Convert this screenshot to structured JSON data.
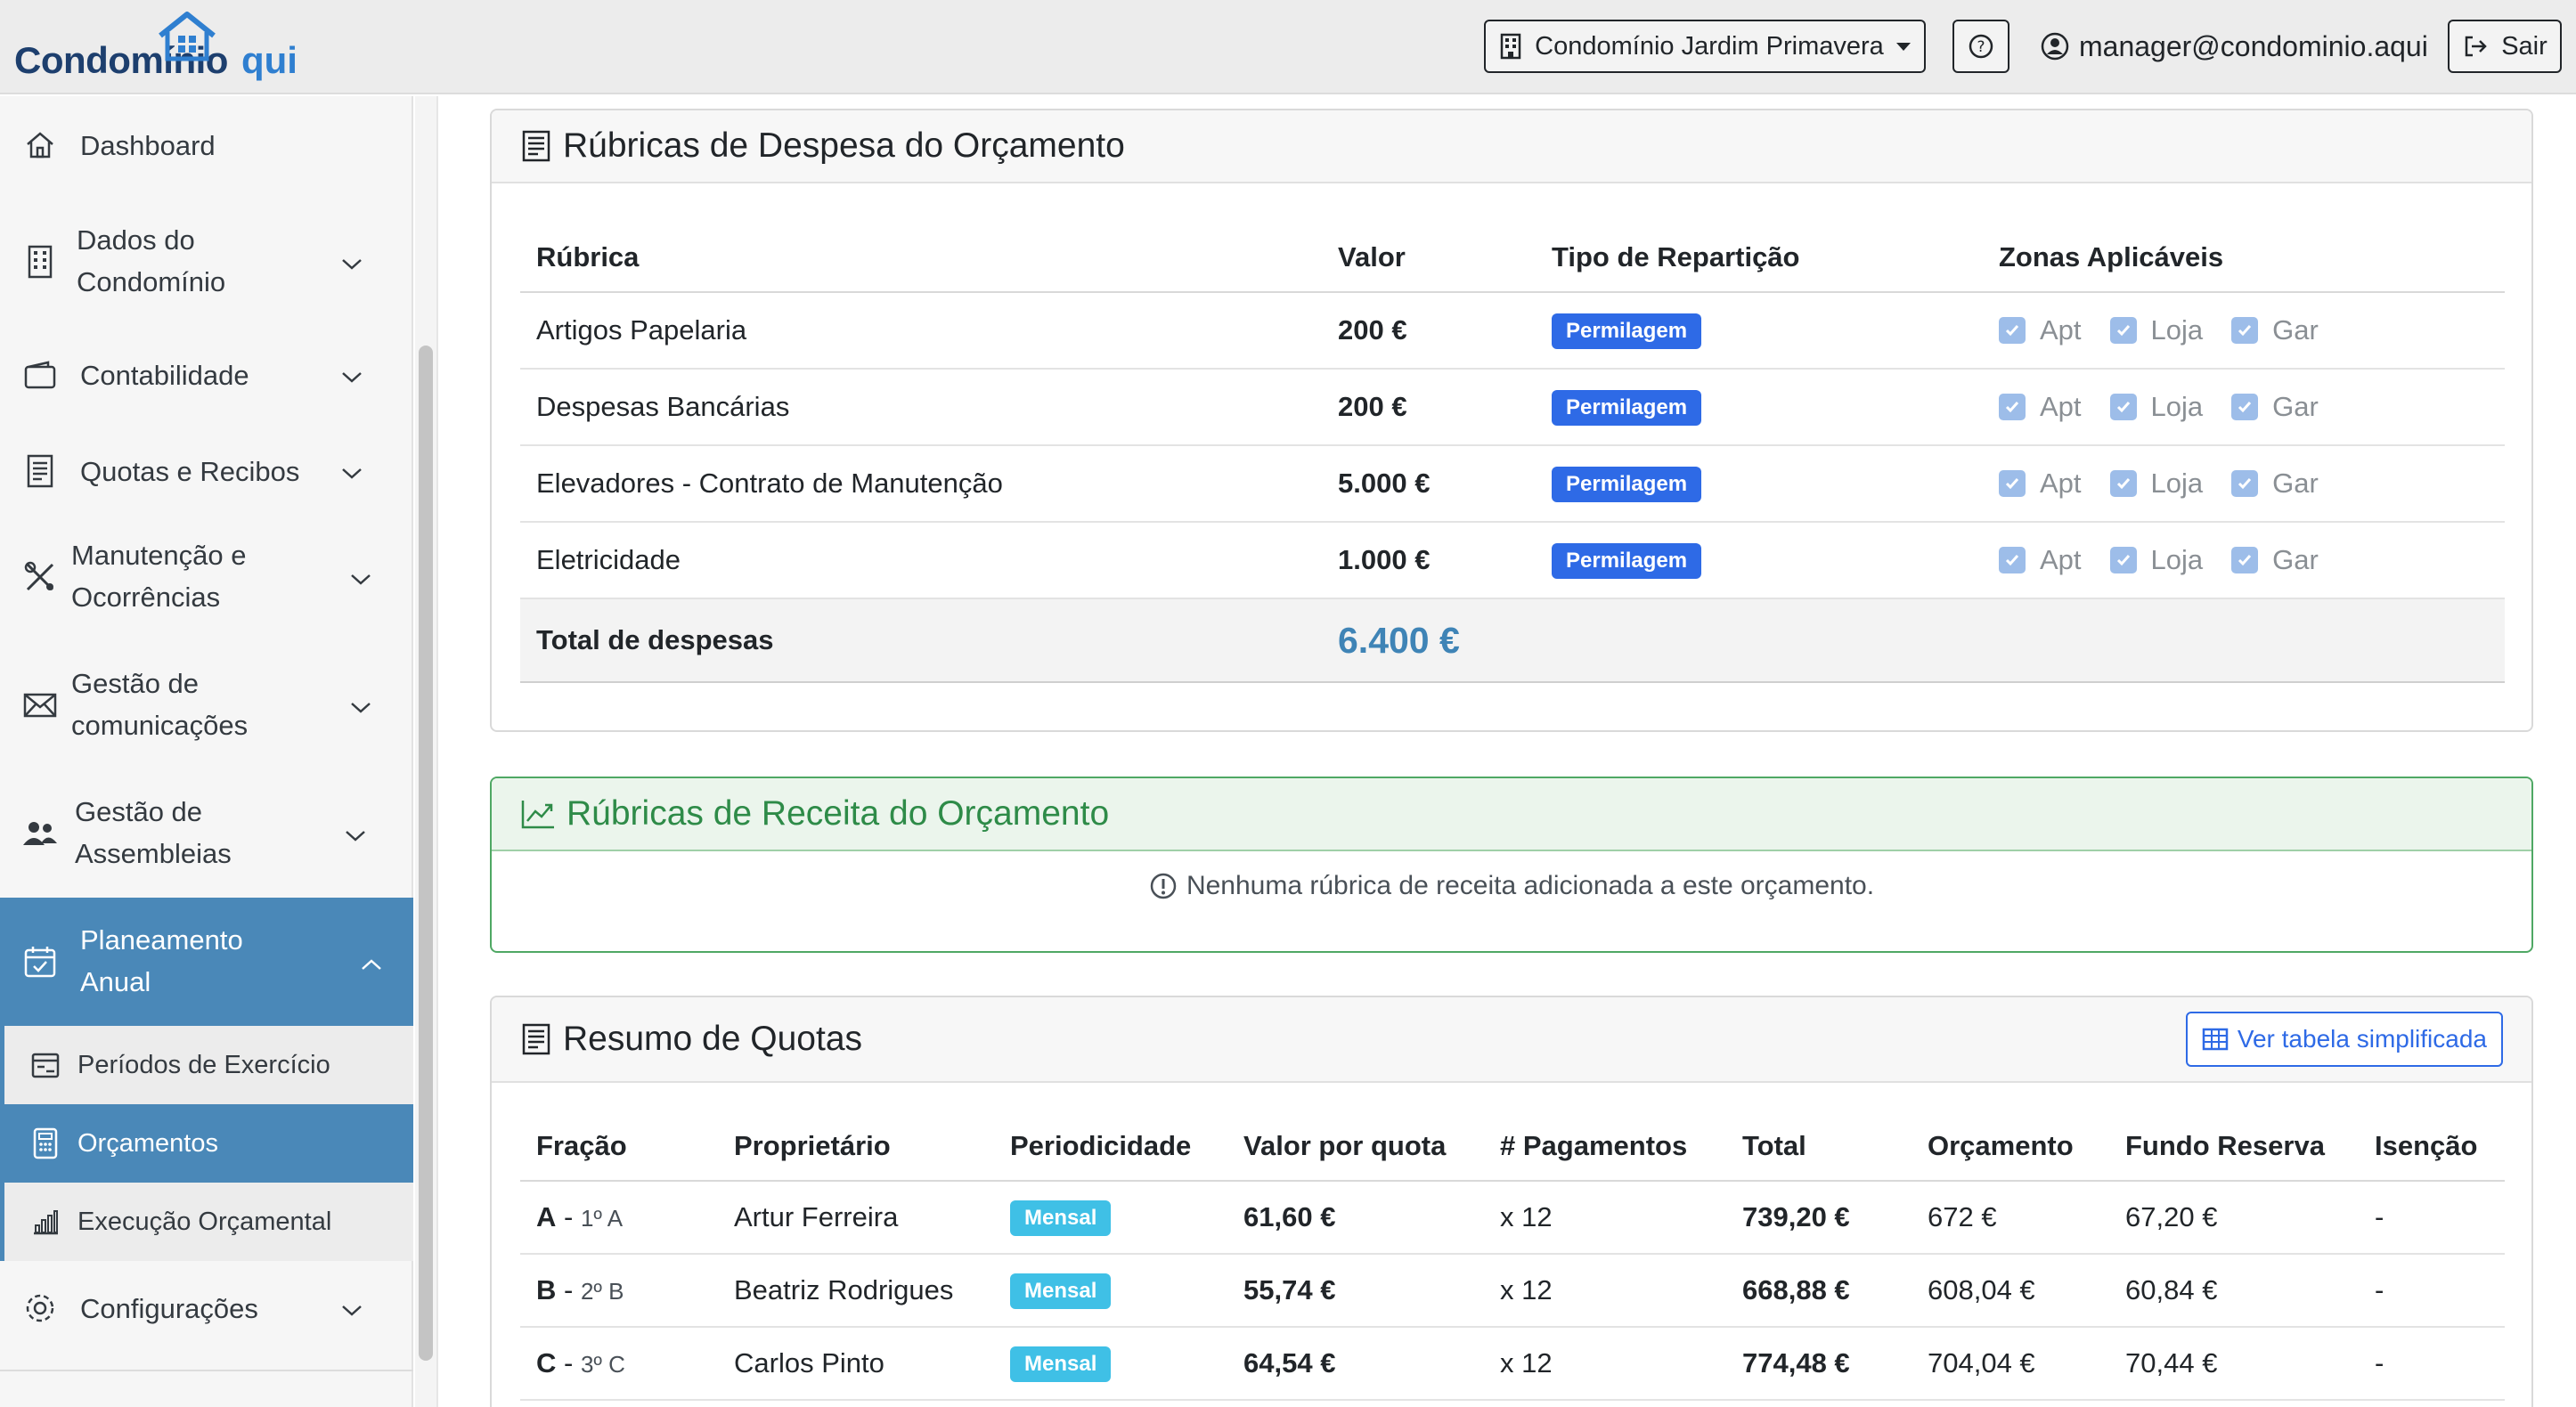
{
  "brand": {
    "part1": "Condomínio",
    "part2": "qui"
  },
  "topbar": {
    "condo_select": "Condomínio Jardim Primavera",
    "user_email": "manager@condominio.aqui",
    "logout_label": "Sair"
  },
  "sidebar": {
    "dashboard": "Dashboard",
    "dados_line1": "Dados do",
    "dados_line2": "Condomínio",
    "contabilidade": "Contabilidade",
    "quotas": "Quotas e Recibos",
    "manut_line1": "Manutenção e",
    "manut_line2": "Ocorrências",
    "comm_line1": "Gestão de",
    "comm_line2": "comunicações",
    "assem_line1": "Gestão de",
    "assem_line2": "Assembleias",
    "plan_line1": "Planeamento",
    "plan_line2": "Anual",
    "sub_periodos": "Períodos de Exercício",
    "sub_orcamentos": "Orçamentos",
    "sub_execucao": "Execução Orçamental",
    "configuracoes": "Configurações"
  },
  "expenses": {
    "title": "Rúbricas de Despesa do Orçamento",
    "headers": [
      "Rúbrica",
      "Valor",
      "Tipo de Repartição",
      "Zonas Aplicáveis"
    ],
    "zones": [
      "Apt",
      "Loja",
      "Gar"
    ],
    "rows": [
      {
        "name": "Artigos Papelaria",
        "value": "200 €",
        "type": "Permilagem"
      },
      {
        "name": "Despesas Bancárias",
        "value": "200 €",
        "type": "Permilagem"
      },
      {
        "name": "Elevadores - Contrato de Manutenção",
        "value": "5.000 €",
        "type": "Permilagem"
      },
      {
        "name": "Eletricidade",
        "value": "1.000 €",
        "type": "Permilagem"
      }
    ],
    "total_label": "Total de despesas",
    "total_value": "6.400 €"
  },
  "revenue": {
    "title": "Rúbricas de Receita do Orçamento",
    "empty_message": "Nenhuma rúbrica de receita adicionada a este orçamento."
  },
  "quotas": {
    "title": "Resumo de Quotas",
    "simple_table_btn": "Ver tabela simplificada",
    "headers": [
      "Fração",
      "Proprietário",
      "Periodicidade",
      "Valor por quota",
      "# Pagamentos",
      "Total",
      "Orçamento",
      "Fundo Reserva",
      "Isenção"
    ],
    "rows": [
      {
        "frac": "A",
        "sep": " - ",
        "floor": "1º A",
        "owner": "Artur Ferreira",
        "period": "Mensal",
        "per_quota": "61,60 €",
        "payments": "x 12",
        "total": "739,20 €",
        "budget": "672 €",
        "reserve": "67,20 €",
        "exempt": "-"
      },
      {
        "frac": "B",
        "sep": " - ",
        "floor": "2º B",
        "owner": "Beatriz Rodrigues",
        "period": "Mensal",
        "per_quota": "55,74 €",
        "payments": "x 12",
        "total": "668,88 €",
        "budget": "608,04 €",
        "reserve": "60,84 €",
        "exempt": "-"
      },
      {
        "frac": "C",
        "sep": " - ",
        "floor": "3º C",
        "owner": "Carlos Pinto",
        "period": "Mensal",
        "per_quota": "64,54 €",
        "payments": "x 12",
        "total": "774,48 €",
        "budget": "704,04 €",
        "reserve": "70,44 €",
        "exempt": "-"
      }
    ]
  },
  "colors": {
    "accent": "#4a88b8",
    "badge_blue": "#2e6ae6",
    "badge_cyan": "#3fc0e6",
    "success": "#2e8b48"
  }
}
